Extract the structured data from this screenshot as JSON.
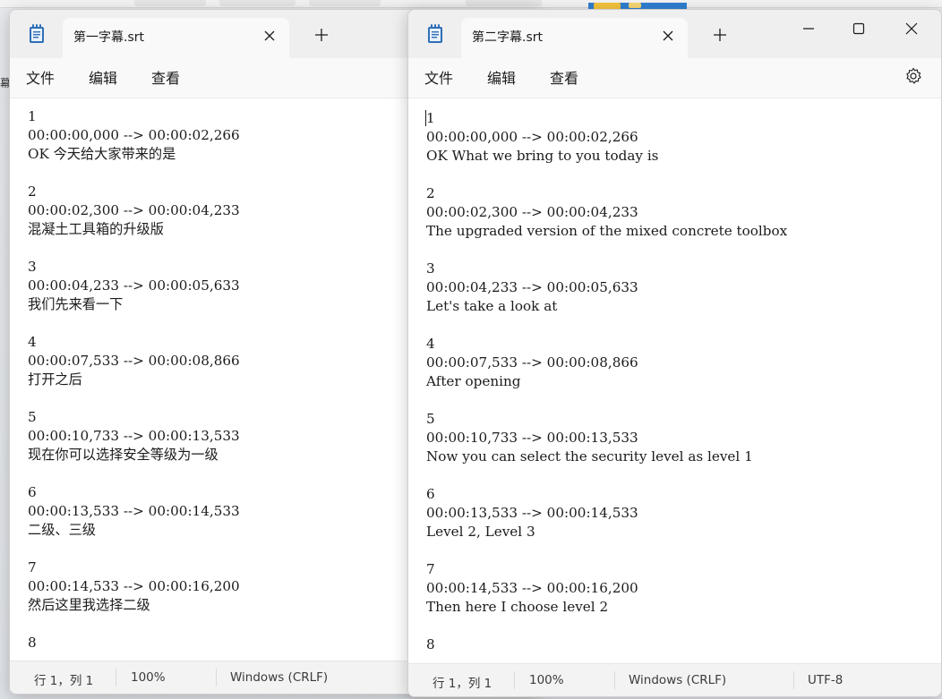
{
  "window1": {
    "tab_title": "第一字幕.srt",
    "menu": [
      "文件",
      "编辑",
      "查看"
    ],
    "lines": [
      "1",
      "00:00:00,000 --> 00:00:02,266",
      "OK 今天给大家带来的是",
      "",
      "2",
      "00:00:02,300 --> 00:00:04,233",
      "混凝土工具箱的升级版",
      "",
      "3",
      "00:00:04,233 --> 00:00:05,633",
      "我们先来看一下",
      "",
      "4",
      "00:00:07,533 --> 00:00:08,866",
      "打开之后",
      "",
      "5",
      "00:00:10,733 --> 00:00:13,533",
      "现在你可以选择安全等级为一级",
      "",
      "6",
      "00:00:13,533 --> 00:00:14,533",
      "二级、三级",
      "",
      "7",
      "00:00:14,533 --> 00:00:16,200",
      "然后这里我选择二级",
      "",
      "8"
    ],
    "status": {
      "position": "行 1，列 1",
      "zoom": "100%",
      "line_ending": "Windows (CRLF)"
    }
  },
  "window2": {
    "tab_title": "第二字幕.srt",
    "menu": [
      "文件",
      "编辑",
      "查看"
    ],
    "lines": [
      "1",
      "00:00:00,000 --> 00:00:02,266",
      "OK What we bring to you today is",
      "",
      "2",
      "00:00:02,300 --> 00:00:04,233",
      "The upgraded version of the mixed concrete toolbox",
      "",
      "3",
      "00:00:04,233 --> 00:00:05,633",
      "Let's take a look at",
      "",
      "4",
      "00:00:07,533 --> 00:00:08,866",
      "After opening",
      "",
      "5",
      "00:00:10,733 --> 00:00:13,533",
      "Now you can select the security level as level 1",
      "",
      "6",
      "00:00:13,533 --> 00:00:14,533",
      "Level 2, Level 3",
      "",
      "7",
      "00:00:14,533 --> 00:00:16,200",
      "Then here I choose level 2",
      "",
      "8"
    ],
    "status": {
      "position": "行 1，列 1",
      "zoom": "100%",
      "line_ending": "Windows (CRLF)",
      "encoding": "UTF-8"
    }
  },
  "background": {
    "peek_char": "幕"
  },
  "icons": {
    "app": "notepad-icon",
    "close_tab": "close-icon",
    "new_tab": "plus-icon",
    "settings": "gear-icon",
    "minimize": "minimize-icon",
    "maximize": "maximize-icon",
    "close_window": "close-icon",
    "folder": "folder-icon"
  },
  "colors": {
    "accent": "#1a73c8",
    "folder": "#f3c33b"
  }
}
